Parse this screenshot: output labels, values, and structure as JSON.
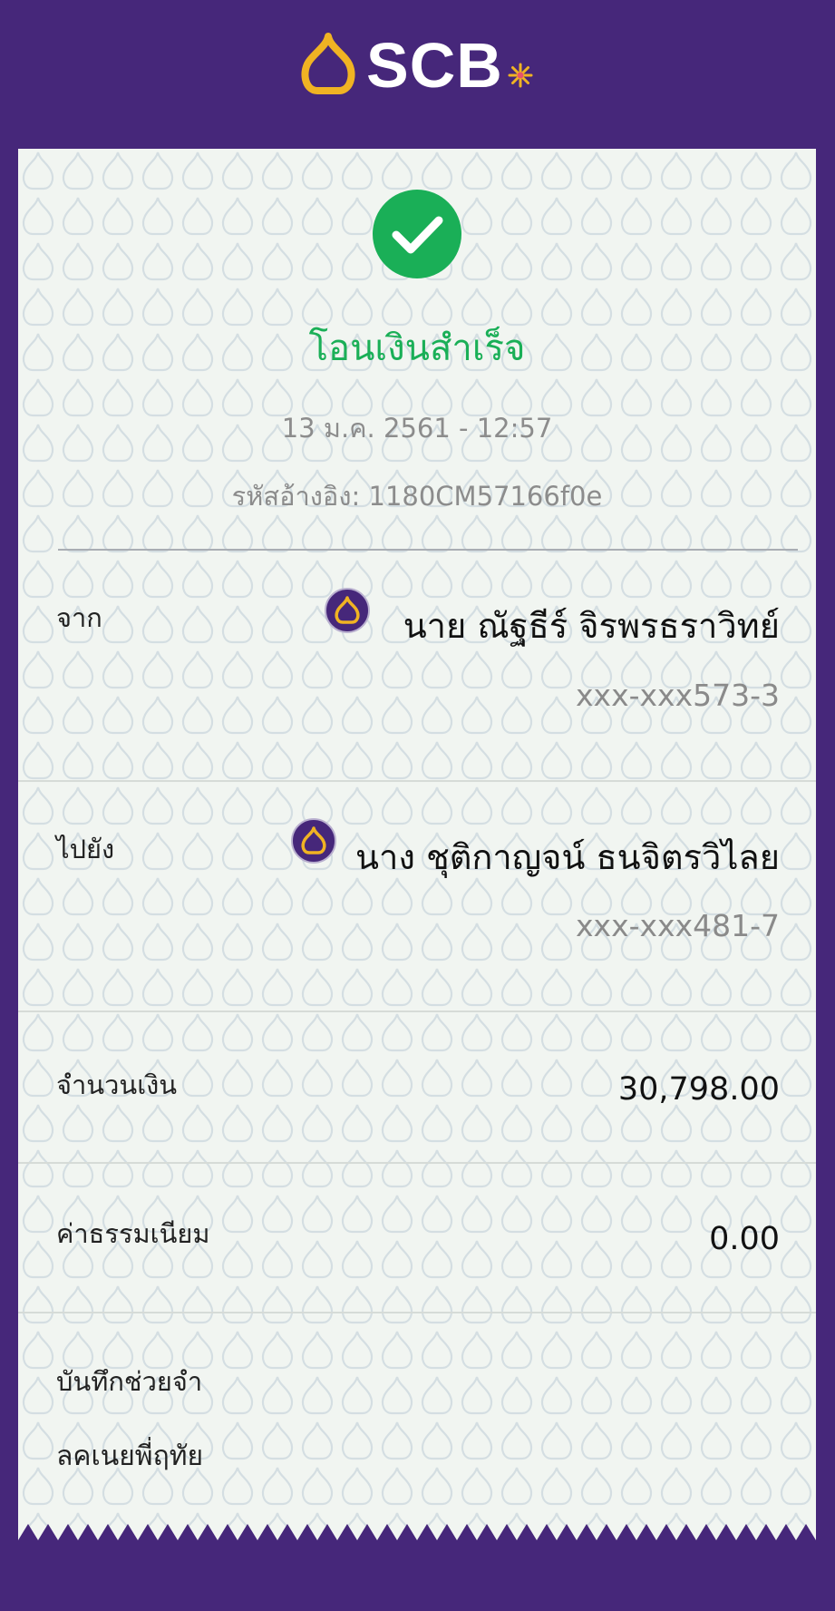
{
  "header": {
    "logo_text": "SCB",
    "logo_alt": "SCB logo"
  },
  "status": {
    "icon": "check-circle-icon",
    "title": "โอนเงินสำเร็จ"
  },
  "datetime": "13 ม.ค. 2561 - 12:57",
  "reference": "รหัสอ้างอิง: 1180CM57166f0e",
  "from": {
    "label": "จาก",
    "name": "นาย ณัฐธีร์ จิรพรธราวิทย์",
    "account": "xxx-xxx573-3",
    "bank_icon": "scb-bank-icon"
  },
  "to": {
    "label": "ไปยัง",
    "name": "นาง ชุติกาญจน์ ธนจิตรวิไลย",
    "account": "xxx-xxx481-7",
    "bank_icon": "scb-bank-icon"
  },
  "amount": {
    "label": "จำนวนเงิน",
    "value": "30,798.00"
  },
  "fee": {
    "label": "ค่าธรรมเนียม",
    "value": "0.00"
  },
  "memo": {
    "label": "บันทึกช่วยจำ",
    "value": "ลคเนยพี่ฤทัย"
  },
  "colors": {
    "brand_purple": "#46277a",
    "success_green": "#1aaf57",
    "gold": "#f0b323",
    "paper": "#f1f5f1"
  }
}
